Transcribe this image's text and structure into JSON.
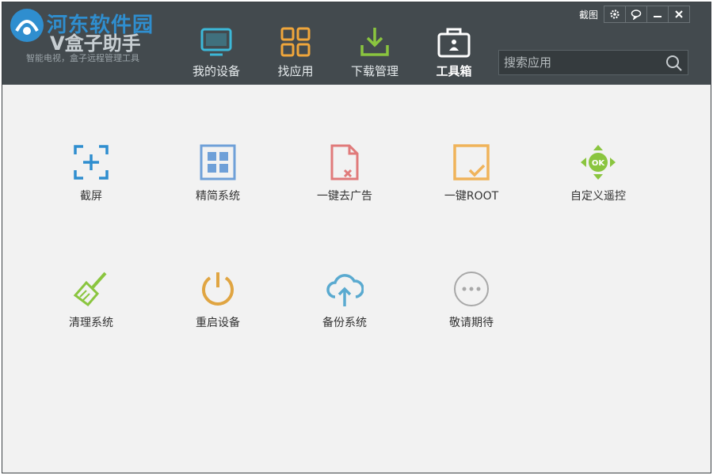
{
  "app": {
    "brand_name": "河东软件园",
    "brand_sub": "V盒子助手",
    "tagline": "智能电视，盒子远程管理工具"
  },
  "nav": {
    "items": [
      {
        "label": "我的设备",
        "icon": "tv-icon",
        "color": "#3cb8d8"
      },
      {
        "label": "找应用",
        "icon": "grid-apps-icon",
        "color": "#f0a63b"
      },
      {
        "label": "下载管理",
        "icon": "download-icon",
        "color": "#8ac53f"
      },
      {
        "label": "工具箱",
        "icon": "toolbox-icon",
        "color": "#ffffff",
        "active": true
      }
    ]
  },
  "search": {
    "placeholder": "搜索应用"
  },
  "window_controls": {
    "screenshot_label": "截图",
    "settings_icon": "gear-icon",
    "feedback_icon": "chat-icon",
    "minimize_icon": "minimize-icon",
    "close_icon": "close-icon"
  },
  "tools": [
    {
      "label": "截屏",
      "icon": "screenshot-icon",
      "color": "#2f8ecf"
    },
    {
      "label": "精简系统",
      "icon": "grid-system-icon",
      "color": "#6fa0d8"
    },
    {
      "label": "一键去广告",
      "icon": "remove-ad-icon",
      "color": "#e07a7a"
    },
    {
      "label": "一键ROOT",
      "icon": "root-icon",
      "color": "#f0b35a"
    },
    {
      "label": "自定义遥控",
      "icon": "remote-control-icon",
      "color": "#8ac53f"
    },
    {
      "label": "清理系统",
      "icon": "broom-icon",
      "color": "#8ac53f"
    },
    {
      "label": "重启设备",
      "icon": "power-icon",
      "color": "#e0a542"
    },
    {
      "label": "备份系统",
      "icon": "cloud-upload-icon",
      "color": "#5aaad0"
    },
    {
      "label": "敬请期待",
      "icon": "more-icon",
      "color": "#a8a8a8"
    }
  ]
}
